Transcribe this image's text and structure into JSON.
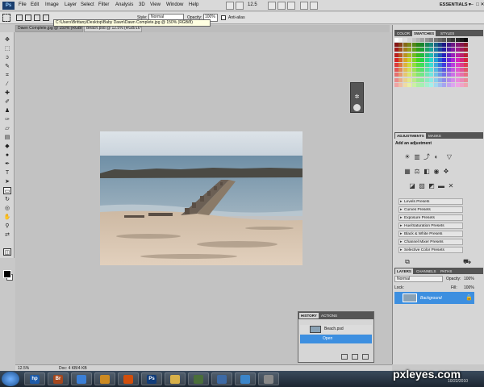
{
  "menubar": {
    "logo": "Ps",
    "items": [
      "File",
      "Edit",
      "Image",
      "Layer",
      "Select",
      "Filter",
      "Analysis",
      "3D",
      "View",
      "Window",
      "Help"
    ],
    "zoom": "12.5",
    "workspace": "ESSENTIALS ▾",
    "window_buttons": [
      "–",
      "□",
      "✕"
    ]
  },
  "options": {
    "style_label": "Style:",
    "style_value": "Normal",
    "opacity_label": "Opacity:",
    "opacity_value": "100%",
    "antialias": "Anti-alias"
  },
  "tabs": [
    {
      "label": "Dawn Complete.jpg @ 150% (RGB/8) ✕"
    },
    {
      "label": "Beach.psd @ 12.5% (RGB/16*) ✕"
    }
  ],
  "tooltip": "C:\\Users\\Brittany\\Desktop\\Baby Dawn\\Dawn Complete.jpg @ 150% (RGB/8)",
  "status": {
    "zoom": "12.5%",
    "doc": "Doc: 4 KB/4 KB"
  },
  "panels": {
    "color_tabs": [
      "COLOR",
      "SWATCHES",
      "STYLES"
    ],
    "adjust_tabs": [
      "ADJUSTMENTS",
      "MASKS"
    ],
    "adjust_title": "Add an adjustment",
    "presets": [
      "Levels Presets",
      "Curves Presets",
      "Exposure Presets",
      "Hue/Saturation Presets",
      "Black & White Presets",
      "Channel Mixer Presets",
      "Selective Color Presets"
    ],
    "layers_tabs": [
      "LAYERS",
      "CHANNELS",
      "PATHS"
    ],
    "blend_mode": "Normal",
    "opacity_label": "Opacity:",
    "opacity_value": "100%",
    "lock_label": "Lock:",
    "fill_label": "Fill:",
    "fill_value": "100%",
    "layer_name": "Background"
  },
  "history": {
    "tabs": [
      "HISTORY",
      "ACTIONS"
    ],
    "snapshot": "Beach.psd",
    "step": "Open"
  },
  "taskbar": {
    "watermark": "pxleyes.com",
    "date": "10/22/2010",
    "apps": [
      "hp",
      "Br",
      "",
      "",
      "",
      "Ps",
      "",
      "",
      "",
      "",
      ""
    ]
  }
}
